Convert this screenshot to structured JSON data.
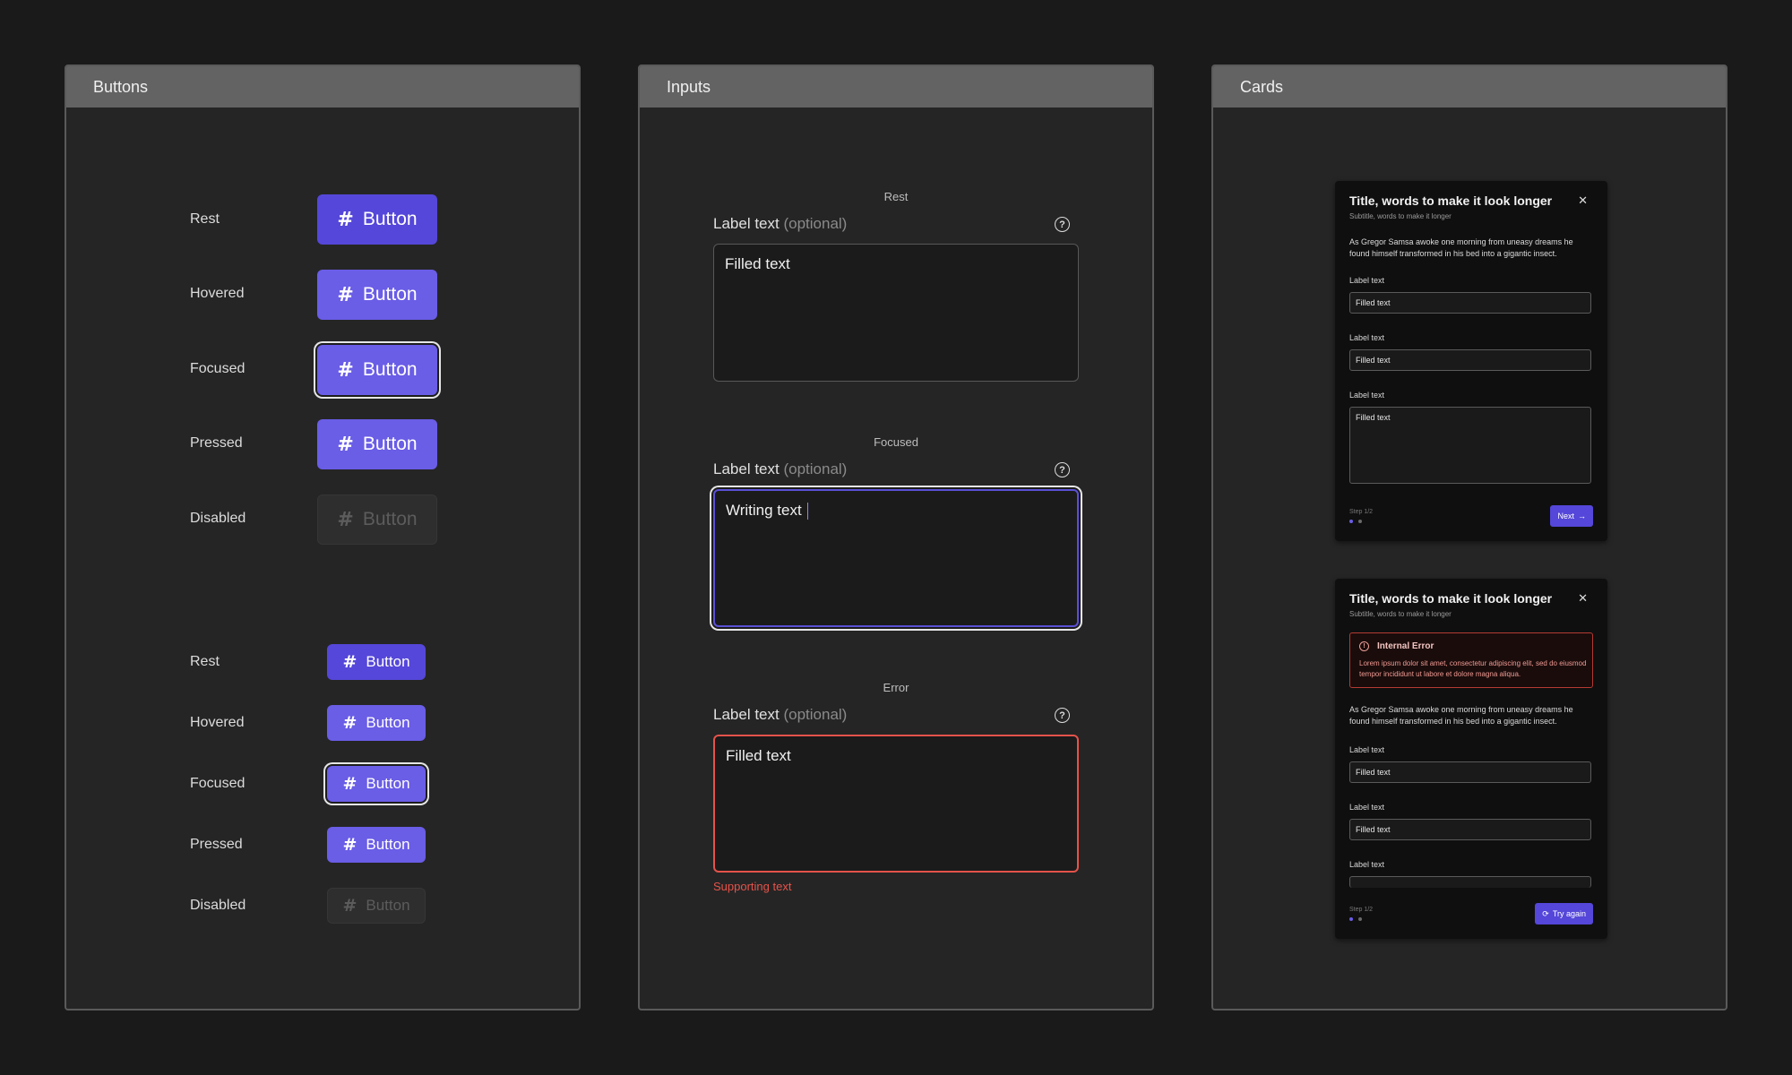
{
  "panels": {
    "buttons": {
      "title": "Buttons"
    },
    "inputs": {
      "title": "Inputs"
    },
    "cards": {
      "title": "Cards"
    }
  },
  "buttons": {
    "label": "Button",
    "icon": "hash-icon",
    "states": [
      "Rest",
      "Hovered",
      "Focused",
      "Pressed",
      "Disabled"
    ]
  },
  "inputs": {
    "label": "Label text",
    "optional": "(optional)",
    "rest": {
      "caption": "Rest",
      "value": "Filled text"
    },
    "focused": {
      "caption": "Focused",
      "value": "Writing text"
    },
    "error": {
      "caption": "Error",
      "value": "Filled text",
      "supporting": "Supporting text"
    }
  },
  "cards": {
    "title": "Title, words to make it look longer",
    "subtitle": "Subtitle, words to make it longer",
    "body": "As Gregor Samsa awoke one morning from uneasy dreams he found himself transformed in his bed into a gigantic insect.",
    "field_label": "Label text",
    "field_value": "Filled text",
    "step": "Step 1/2",
    "next": "Next",
    "try_again": "Try again",
    "alert_title": "Internal Error",
    "alert_body": "Lorem ipsum dolor sit amet, consectetur adipiscing elit, sed do eiusmod tempor incididunt ut labore et dolore magna aliqua."
  },
  "colors": {
    "accent": "#5547d9",
    "accent_hover": "#6a5de6",
    "error": "#e5534b"
  }
}
